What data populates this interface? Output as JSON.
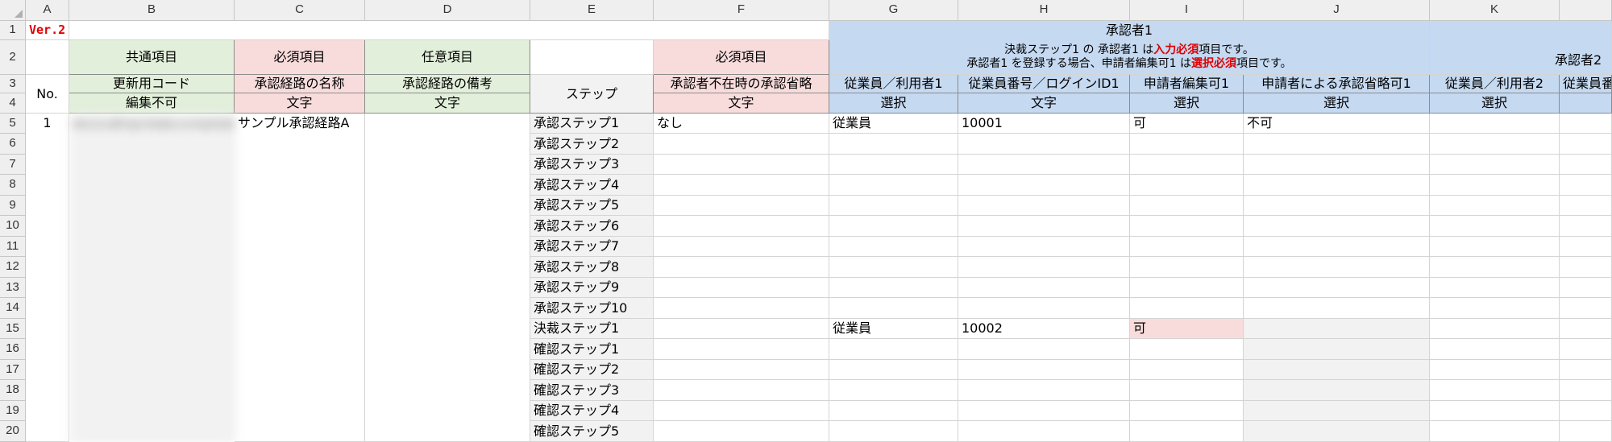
{
  "spreadsheet": {
    "version": "Ver.2",
    "columns": [
      "A",
      "B",
      "C",
      "D",
      "E",
      "F",
      "G",
      "H",
      "I",
      "J",
      "K"
    ],
    "rows": [
      "1",
      "2",
      "3",
      "4",
      "5",
      "6",
      "7",
      "8",
      "9",
      "10",
      "11",
      "12",
      "13",
      "14",
      "15",
      "16",
      "17",
      "18",
      "19",
      "20"
    ],
    "group_headers": {
      "common": "共通項目",
      "required": "必須項目",
      "optional": "任意項目",
      "required_f": "必須項目",
      "approver1": "承認者1",
      "approver2": "承認者2"
    },
    "note": {
      "line1_a": "決裁ステップ1 の 承認者1 は",
      "line1_red": "入力必須",
      "line1_b": "項目です。",
      "line2_a": "承認者1 を登録する場合、申請者編集可1 は",
      "line2_red": "選択必須",
      "line2_b": "項目です。"
    },
    "headers": {
      "no": "No.",
      "b3": "更新用コード",
      "b4": "編集不可",
      "c3": "承認経路の名称",
      "c4": "文字",
      "d3": "承認経路の備考",
      "d4": "文字",
      "e": "ステップ",
      "f3": "承認者不在時の承認省略",
      "f4": "文字",
      "g3": "従業員／利用者1",
      "g4": "選択",
      "h3": "従業員番号／ログインID1",
      "h4": "文字",
      "i3": "申請者編集可1",
      "i4": "選択",
      "j3": "申請者による承認省略可1",
      "j4": "選択",
      "k3": "従業員／利用者2",
      "k4": "選択",
      "l3": "従業員番"
    },
    "record": {
      "no": "1",
      "code": "Ab12cdEFgh34ijKLmnOp5Q67rs89tUvw",
      "name": "サンプル承認経路A"
    },
    "steps": [
      "承認ステップ1",
      "承認ステップ2",
      "承認ステップ3",
      "承認ステップ4",
      "承認ステップ5",
      "承認ステップ6",
      "承認ステップ7",
      "承認ステップ8",
      "承認ステップ9",
      "承認ステップ10",
      "決裁ステップ1",
      "確認ステップ1",
      "確認ステップ2",
      "確認ステップ3",
      "確認ステップ4",
      "確認ステップ5"
    ],
    "row5": {
      "f": "なし",
      "g": "従業員",
      "h": "10001",
      "i": "可",
      "j": "不可"
    },
    "row15": {
      "g": "従業員",
      "h": "10002",
      "i": "可"
    }
  }
}
